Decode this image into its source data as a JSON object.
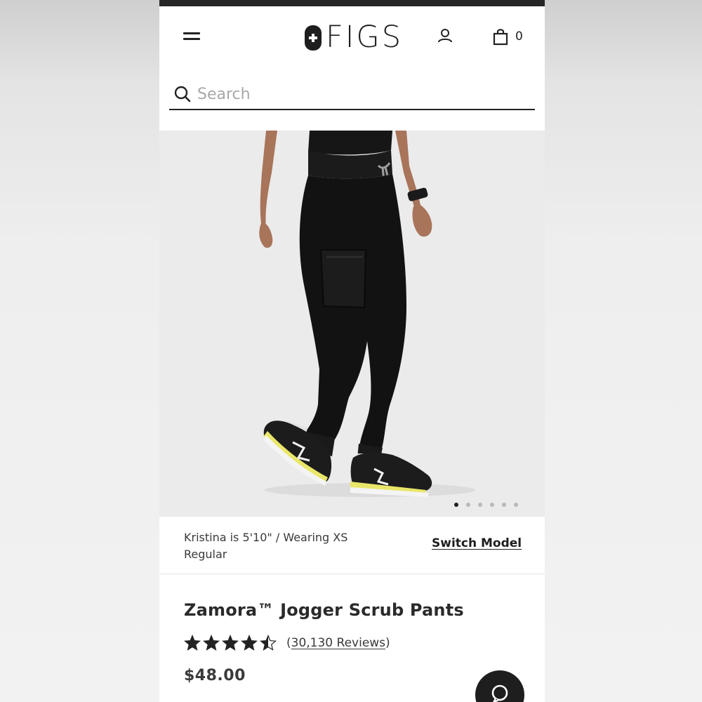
{
  "header": {
    "logo_text": "FIGS",
    "cart_count": "0",
    "icons": {
      "menu": "hamburger-menu-icon",
      "account": "user-icon",
      "cart": "shopping-bag-icon",
      "logo": "cross-logo-icon"
    }
  },
  "search": {
    "placeholder": "Search",
    "value": ""
  },
  "gallery": {
    "image": "woman wearing black jogger scrub pants with black sneakers",
    "slide_count": 6,
    "active_slide": 1
  },
  "model_info": {
    "text": "Kristina is 5'10\" / Wearing XS Regular",
    "switch_label": "Switch Model"
  },
  "product": {
    "title": "Zamora™ Jogger Scrub Pants",
    "rating": 4.5,
    "reviews_label": "30,130 Reviews",
    "price": "$48.00"
  },
  "chat": {
    "icon": "chat-bubble-icon"
  },
  "colors": {
    "ink": "#1e1e1e",
    "text": "#3a3a3a",
    "muted": "#a8a8a8",
    "image_bg": "#ebebeb",
    "dot_inactive": "#b9b9b9"
  }
}
